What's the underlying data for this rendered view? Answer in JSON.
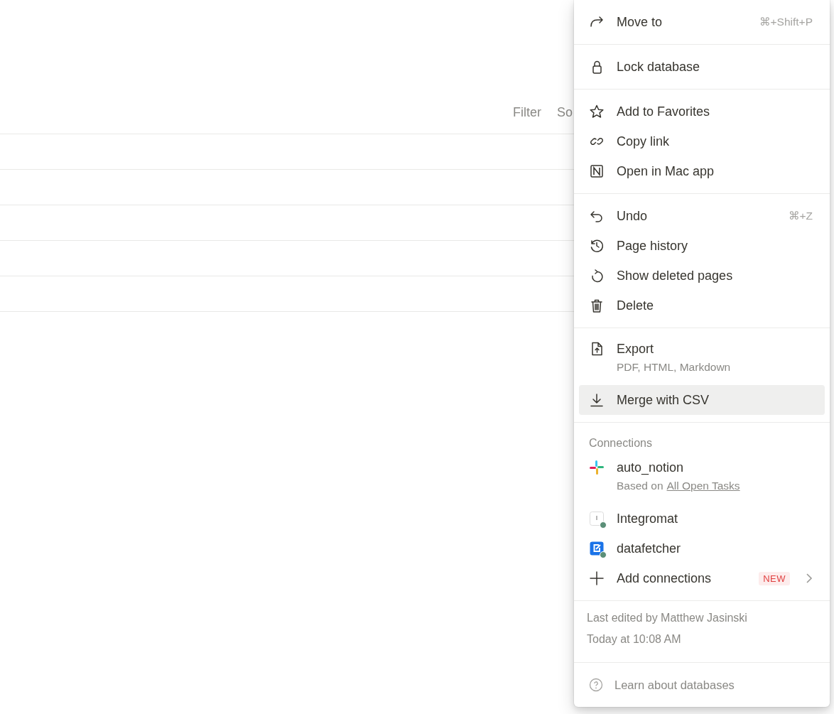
{
  "toolbar": {
    "buttons": [
      "Filter",
      "So"
    ]
  },
  "menu": {
    "sections": [
      {
        "items": [
          {
            "kind": "move",
            "label": "Move to",
            "shortcut": "⌘+Shift+P",
            "selected": false
          }
        ]
      },
      {
        "items": [
          {
            "kind": "lock",
            "label": "Lock database",
            "selected": false
          }
        ]
      },
      {
        "items": [
          {
            "kind": "favorite",
            "label": "Add to Favorites",
            "selected": false
          },
          {
            "kind": "link",
            "label": "Copy link",
            "selected": false
          },
          {
            "kind": "app",
            "label": "Open in Mac app",
            "selected": false
          }
        ]
      },
      {
        "items": [
          {
            "kind": "undo",
            "label": "Undo",
            "shortcut": "⌘+Z",
            "selected": false
          },
          {
            "kind": "history",
            "label": "Page history",
            "selected": false
          },
          {
            "kind": "restore",
            "label": "Show deleted pages",
            "selected": false
          },
          {
            "kind": "delete",
            "label": "Delete",
            "selected": false
          }
        ]
      },
      {
        "items": [
          {
            "kind": "export",
            "label": "Export",
            "subtext": "PDF, HTML, Markdown",
            "selected": false
          },
          {
            "kind": "merge",
            "label": "Merge with CSV",
            "selected": true
          }
        ]
      },
      {
        "heading": "Connections",
        "items": [
          {
            "kind": "slack",
            "label": "auto_notion",
            "subtext": "Based on",
            "link": "All Open Tasks",
            "selected": false
          },
          {
            "kind": "integromat",
            "label": "Integromat",
            "color": "#5b8f78",
            "selected": false
          },
          {
            "kind": "datafetcher",
            "label": "datafetcher",
            "color": "#5b8f78",
            "selected": false
          },
          {
            "kind": "add",
            "label": "Add connections",
            "badge": "NEW",
            "chevron": true,
            "selected": false
          }
        ]
      }
    ],
    "footer": {
      "lines": [
        "Last edited by Matthew Jasinski",
        "Today at 10:08 AM"
      ]
    },
    "help": {
      "label": "Learn about databases"
    }
  }
}
